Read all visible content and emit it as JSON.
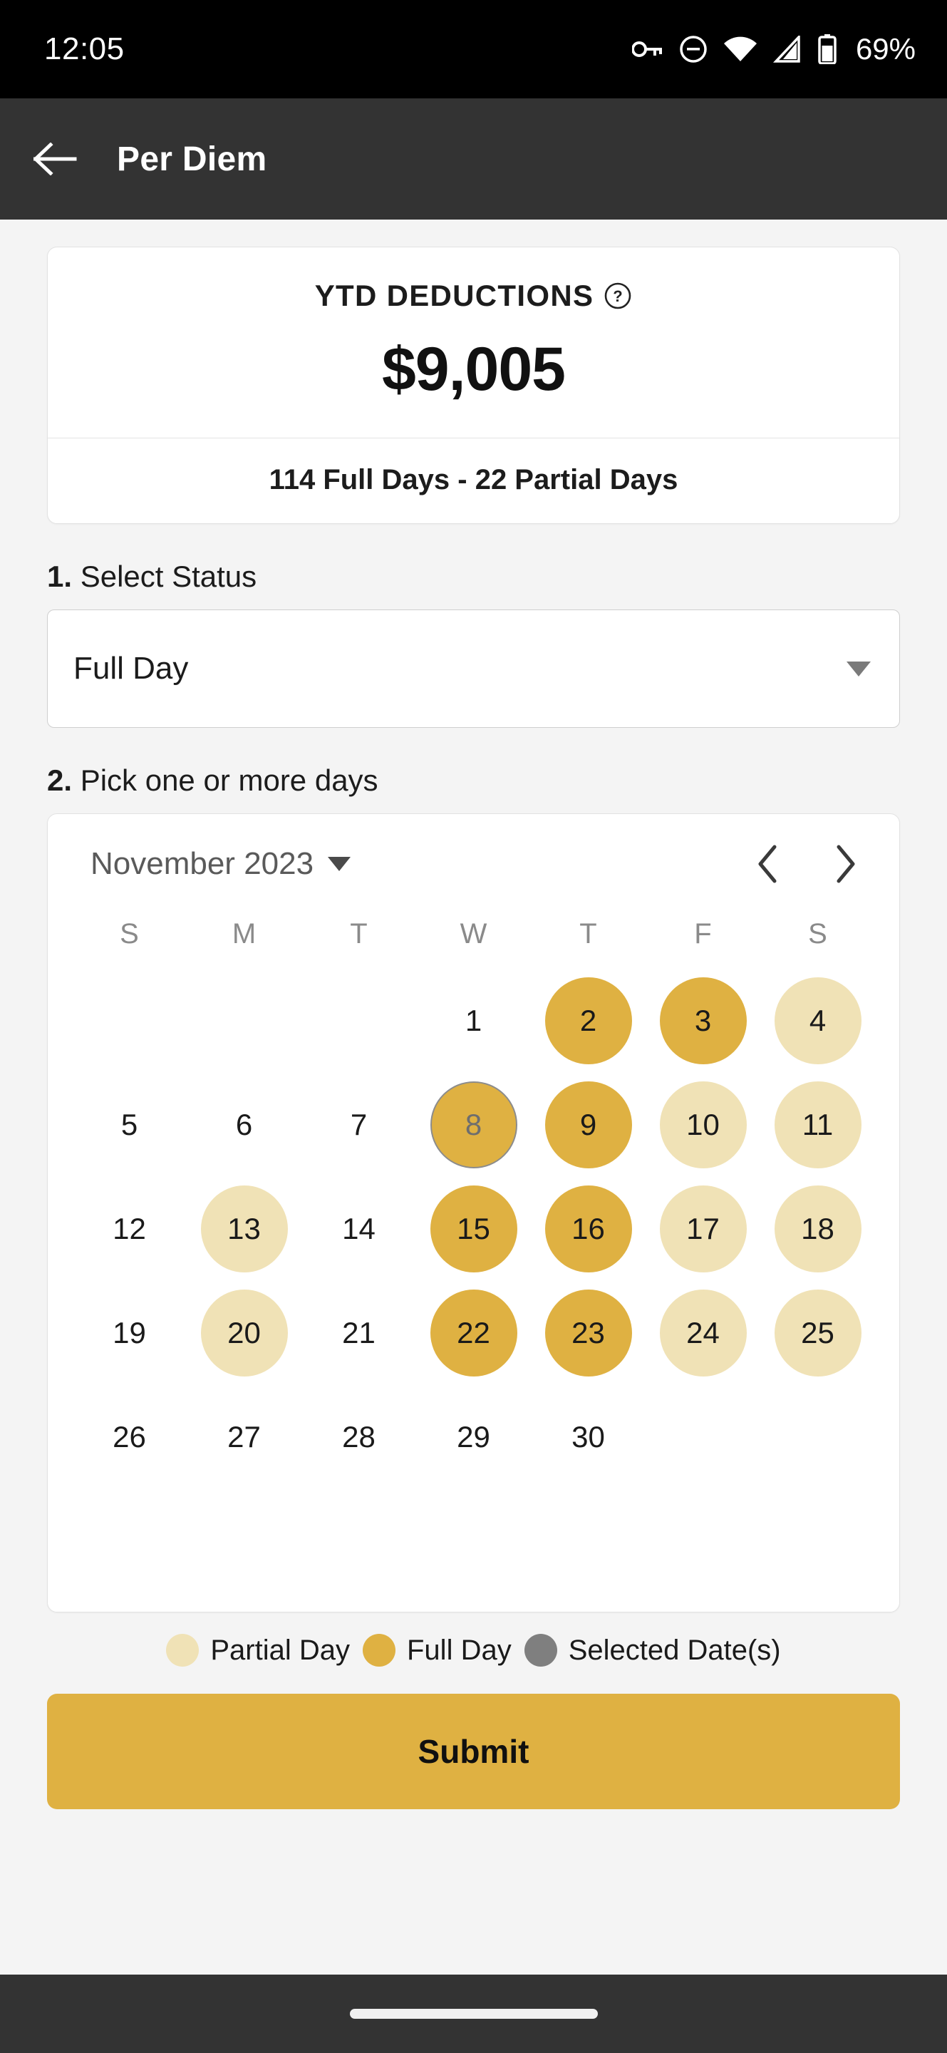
{
  "status_bar": {
    "time": "12:05",
    "battery_percent": "69%",
    "icons": [
      "key-icon",
      "do-not-disturb-icon",
      "wifi-icon",
      "cellular-signal-icon",
      "battery-icon"
    ]
  },
  "app_bar": {
    "back_label": "back-arrow",
    "title": "Per Diem"
  },
  "ytd_card": {
    "label": "YTD DEDUCTIONS",
    "help_icon": "help-circle-icon",
    "amount": "$9,005",
    "days_summary": "114 Full Days - 22 Partial Days"
  },
  "step1": {
    "number": "1.",
    "text": " Select Status",
    "select": {
      "value": "Full Day",
      "options": [
        "Full Day",
        "Partial Day"
      ]
    }
  },
  "step2": {
    "number": "2.",
    "text": " Pick one or more days"
  },
  "calendar": {
    "month_label": "November 2023",
    "prev_label": "previous-month",
    "next_label": "next-month",
    "weekdays": [
      "S",
      "M",
      "T",
      "W",
      "T",
      "F",
      "S"
    ],
    "leading_blanks": 3,
    "days": [
      {
        "n": "1",
        "state": "none"
      },
      {
        "n": "2",
        "state": "full"
      },
      {
        "n": "3",
        "state": "full"
      },
      {
        "n": "4",
        "state": "partial"
      },
      {
        "n": "5",
        "state": "none"
      },
      {
        "n": "6",
        "state": "none"
      },
      {
        "n": "7",
        "state": "none"
      },
      {
        "n": "8",
        "state": "full selected"
      },
      {
        "n": "9",
        "state": "full"
      },
      {
        "n": "10",
        "state": "partial"
      },
      {
        "n": "11",
        "state": "partial"
      },
      {
        "n": "12",
        "state": "none"
      },
      {
        "n": "13",
        "state": "partial"
      },
      {
        "n": "14",
        "state": "none"
      },
      {
        "n": "15",
        "state": "full"
      },
      {
        "n": "16",
        "state": "full"
      },
      {
        "n": "17",
        "state": "partial"
      },
      {
        "n": "18",
        "state": "partial"
      },
      {
        "n": "19",
        "state": "none"
      },
      {
        "n": "20",
        "state": "partial"
      },
      {
        "n": "21",
        "state": "none"
      },
      {
        "n": "22",
        "state": "full"
      },
      {
        "n": "23",
        "state": "full"
      },
      {
        "n": "24",
        "state": "partial"
      },
      {
        "n": "25",
        "state": "partial"
      },
      {
        "n": "26",
        "state": "none"
      },
      {
        "n": "27",
        "state": "none"
      },
      {
        "n": "28",
        "state": "none"
      },
      {
        "n": "29",
        "state": "none"
      },
      {
        "n": "30",
        "state": "none"
      }
    ],
    "trailing_blanks": 9
  },
  "legend": [
    {
      "label": "Partial Day",
      "color": "#f0e2b6"
    },
    {
      "label": "Full Day",
      "color": "#dfb142"
    },
    {
      "label": "Selected Date(s)",
      "color": "#7f7f7f"
    }
  ],
  "submit": {
    "label": "Submit"
  },
  "nav_bar": {
    "home_indicator": "home-indicator"
  },
  "colors": {
    "accent_full": "#dfb142",
    "accent_partial": "#f0e2b6",
    "selected_ring": "#8c8c8c",
    "appbar": "#333333",
    "page_bg": "#f4f4f4"
  }
}
